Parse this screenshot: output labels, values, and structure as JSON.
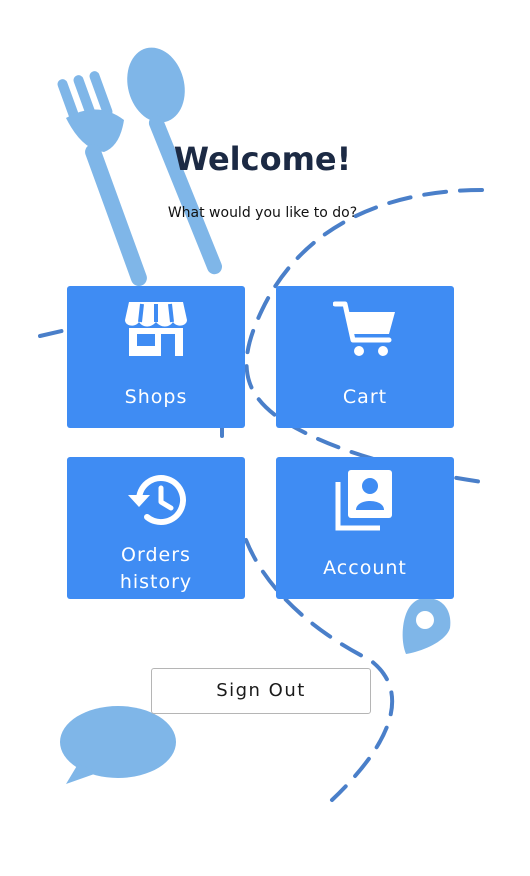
{
  "header": {
    "title": "Welcome!",
    "subtitle": "What would you like to do?"
  },
  "menu": {
    "tiles": [
      {
        "label": "Shops",
        "icon": "storefront-icon"
      },
      {
        "label": "Cart",
        "icon": "shopping-cart-icon"
      },
      {
        "label": "Orders\nhistory",
        "icon": "history-icon"
      },
      {
        "label": "Account",
        "icon": "contacts-icon"
      }
    ]
  },
  "actions": {
    "sign_out_label": "Sign Out"
  },
  "decor": {
    "icons": [
      "fork-icon",
      "spoon-icon",
      "map-pin-icon",
      "chat-bubble-icon"
    ]
  },
  "colors": {
    "tile_bg": "#3f8cf3",
    "title_color": "#1c2a44",
    "decor_light": "#7fb6e8",
    "route_dashes": "#4a7fc9"
  }
}
